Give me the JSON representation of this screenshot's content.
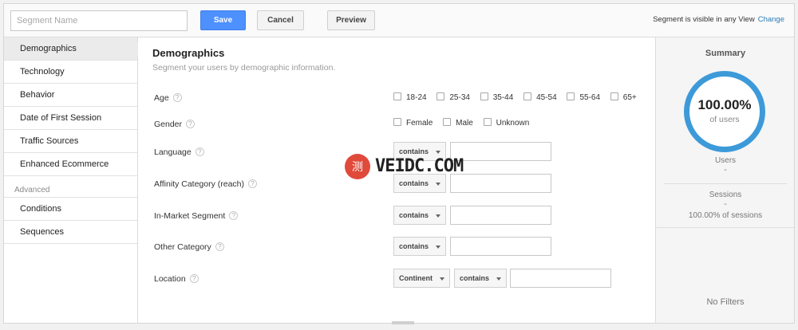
{
  "topbar": {
    "segment_name_placeholder": "Segment Name",
    "save_label": "Save",
    "cancel_label": "Cancel",
    "preview_label": "Preview",
    "visibility_text": "Segment is visible in any View",
    "change_label": "Change"
  },
  "sidebar": {
    "items": [
      {
        "label": "Demographics",
        "active": true
      },
      {
        "label": "Technology"
      },
      {
        "label": "Behavior"
      },
      {
        "label": "Date of First Session"
      },
      {
        "label": "Traffic Sources"
      },
      {
        "label": "Enhanced Ecommerce"
      }
    ],
    "advanced_label": "Advanced",
    "advanced_items": [
      {
        "label": "Conditions"
      },
      {
        "label": "Sequences"
      }
    ]
  },
  "main": {
    "title": "Demographics",
    "subtitle": "Segment your users by demographic information.",
    "help_glyph": "?",
    "rows": {
      "age": {
        "label": "Age",
        "options": [
          "18-24",
          "25-34",
          "35-44",
          "45-54",
          "55-64",
          "65+"
        ]
      },
      "gender": {
        "label": "Gender",
        "options": [
          "Female",
          "Male",
          "Unknown"
        ]
      },
      "language": {
        "label": "Language",
        "operator": "contains"
      },
      "affinity": {
        "label": "Affinity Category (reach)",
        "operator": "contains"
      },
      "in_market": {
        "label": "In-Market Segment",
        "operator": "contains"
      },
      "other": {
        "label": "Other Category",
        "operator": "contains"
      },
      "location": {
        "label": "Location",
        "scope": "Continent",
        "operator": "contains"
      }
    }
  },
  "summary": {
    "title": "Summary",
    "percent": "100.00%",
    "percent_label": "of users",
    "users_label": "Users",
    "users_value": "-",
    "sessions_label": "Sessions",
    "sessions_value": "-",
    "sessions_percent": "100.00% of sessions",
    "no_filters": "No Filters"
  },
  "watermark": {
    "badge": "测",
    "text": "VEIDC.COM"
  },
  "colors": {
    "save_button": "#4d90fe",
    "summary_ring": "#3d9ad9",
    "change_link": "#2a7ab8"
  }
}
